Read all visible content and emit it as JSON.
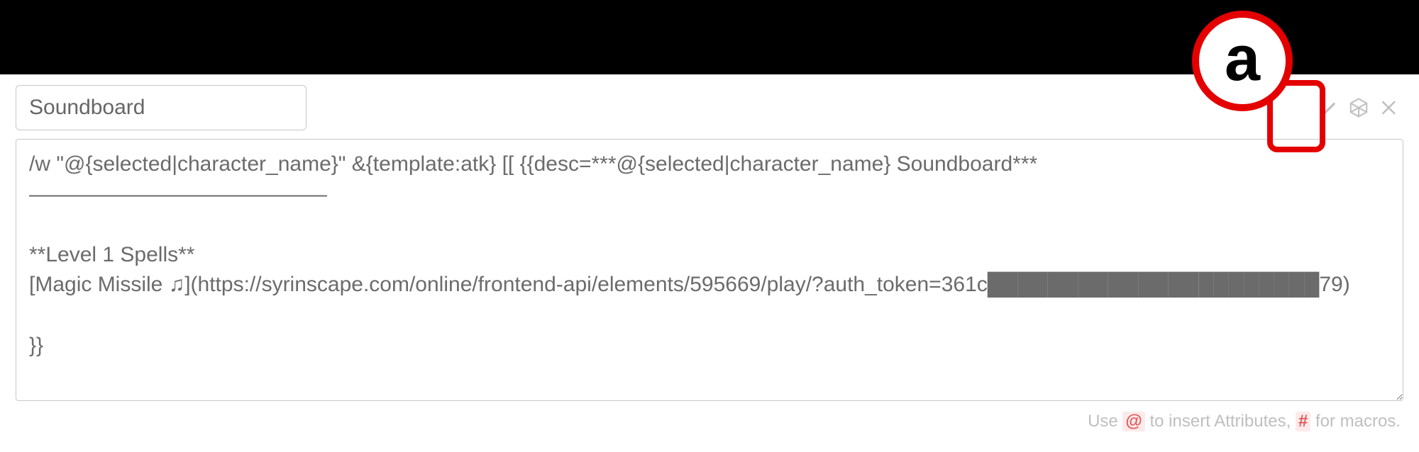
{
  "name_input": {
    "value": "Soundboard"
  },
  "macro_textarea": {
    "value": "/w \"@{selected|character_name}\" &{template:atk} [[ {{desc=***@{selected|character_name} Soundboard***\n——————————————\n\n**Level 1 Spells**\n[Magic Missile ♫](https://syrinscape.com/online/frontend-api/elements/595669/play/?auth_token=361c██████████████████████79)\n\n}}"
  },
  "hint": {
    "prefix": "Use ",
    "at": "@",
    "mid": " to insert Attributes, ",
    "hash": "#",
    "suffix": " for macros."
  },
  "annotation": {
    "label": "a"
  }
}
